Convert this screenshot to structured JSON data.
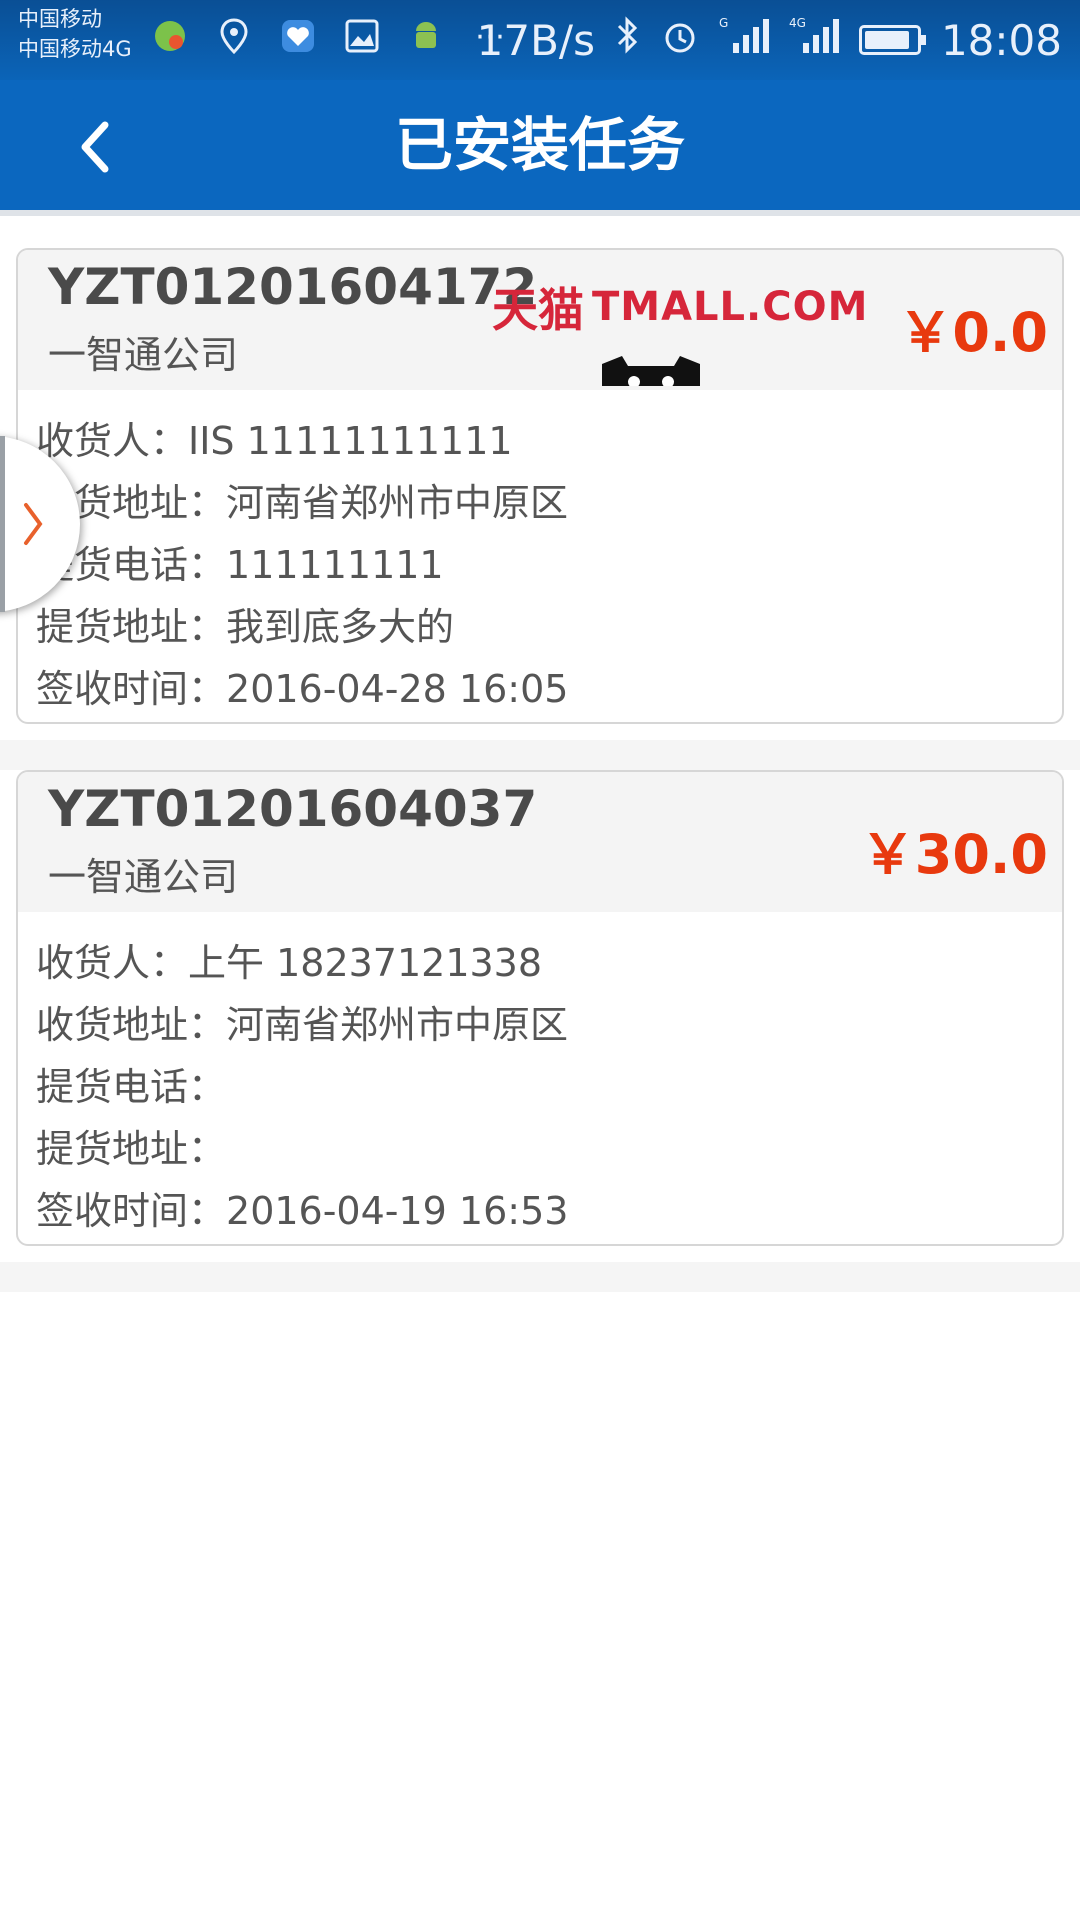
{
  "status_bar": {
    "carrier1": "中国移动",
    "carrier2": "中国移动4G",
    "net_speed": "17B/s",
    "time": "18:08"
  },
  "header": {
    "title": "已安装任务"
  },
  "ad": {
    "brand_cn": "天猫",
    "brand_en": "TMALL.COM"
  },
  "tasks": [
    {
      "order_no": "YZT01201604172",
      "company": "一智通公司",
      "price": "￥0.0",
      "rows": [
        {
          "label": "收货人：",
          "value": "IIS   11111111111"
        },
        {
          "label": "收货地址：",
          "value": "河南省郑州市中原区"
        },
        {
          "label": "提货电话：",
          "value": "111111111"
        },
        {
          "label": "提货地址：",
          "value": "我到底多大的"
        },
        {
          "label": "签收时间：",
          "value": "2016-04-28 16:05"
        }
      ]
    },
    {
      "order_no": "YZT01201604037",
      "company": "一智通公司",
      "price": "￥30.0",
      "rows": [
        {
          "label": "收货人：",
          "value": "上午   18237121338"
        },
        {
          "label": "收货地址：",
          "value": "河南省郑州市中原区"
        },
        {
          "label": "提货电话：",
          "value": ""
        },
        {
          "label": "提货地址：",
          "value": ""
        },
        {
          "label": "签收时间：",
          "value": "2016-04-19 16:53"
        }
      ]
    }
  ],
  "colors": {
    "header_blue": "#0b67bf",
    "price_red": "#e8390e",
    "ad_red": "#d6263a"
  },
  "icons": {
    "back": "chevron-left-icon",
    "side_handle": "chevron-right-icon"
  }
}
